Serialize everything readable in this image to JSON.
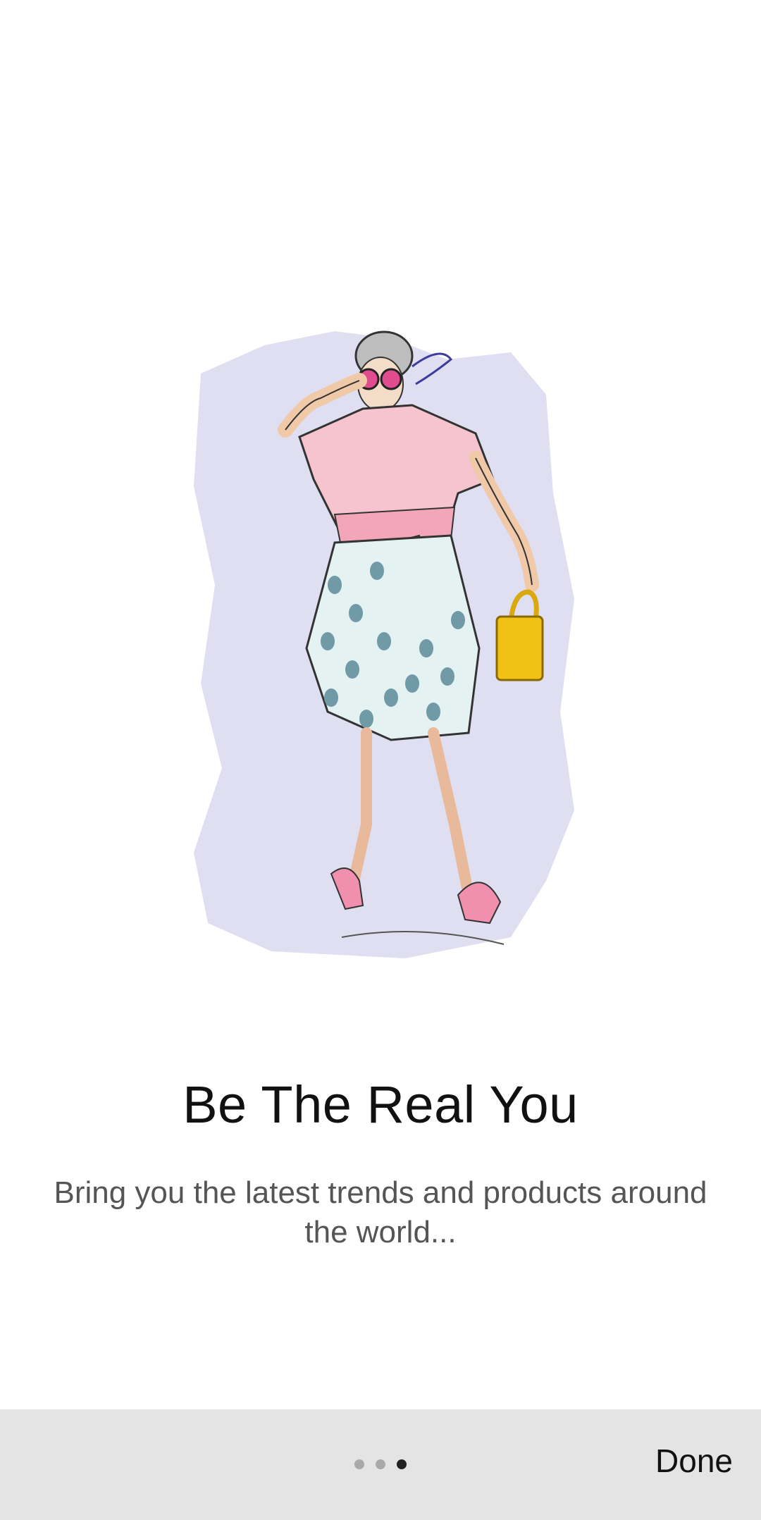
{
  "onboarding": {
    "title": "Be The Real You",
    "subtitle": "Bring you the latest trends and products around the world...",
    "illustration_icon": "fashion-woman-illustration",
    "page_count": 3,
    "current_page": 3
  },
  "bottom_bar": {
    "done_label": "Done"
  },
  "colors": {
    "background": "#ffffff",
    "bottom_bar": "#e4e4e4",
    "title_text": "#111111",
    "subtitle_text": "#555555",
    "dot_inactive": "#a9a9a9",
    "dot_active": "#222222",
    "illustration_backdrop": "#dcdcf0"
  }
}
